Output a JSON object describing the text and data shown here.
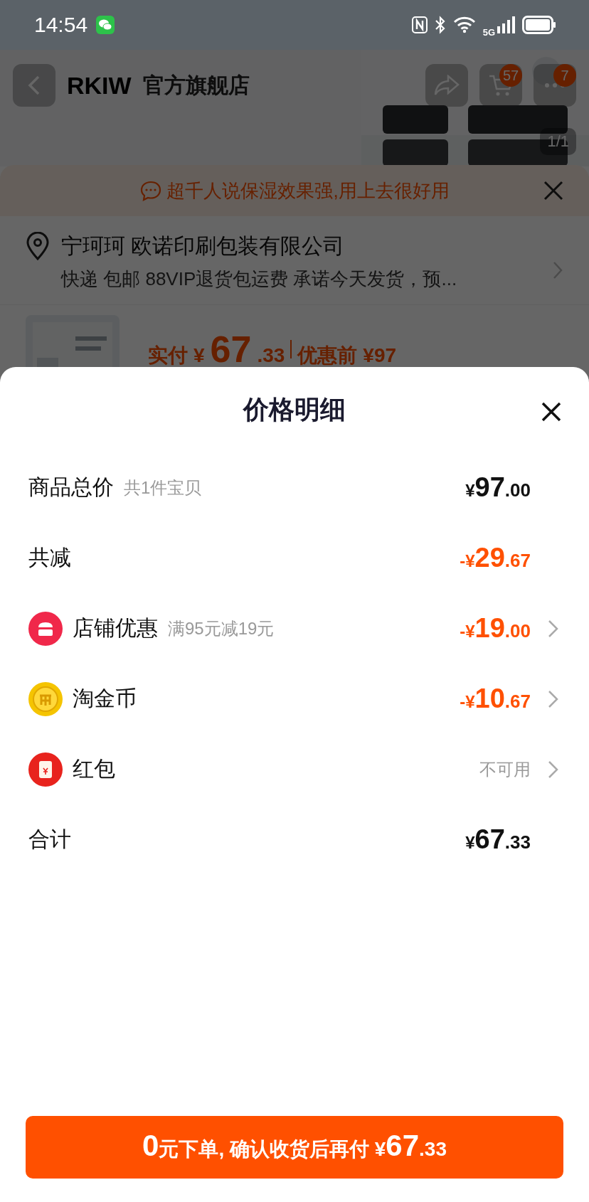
{
  "status_bar": {
    "time": "14:54",
    "network": "5G"
  },
  "header": {
    "brand": "RKIW",
    "store_name": "官方旗舰店",
    "cart_badge": "57",
    "more_badge": "7",
    "image_counter": "1/1"
  },
  "order_sheet": {
    "banner": "超千人说保湿效果强,用上去很好用",
    "address": {
      "name": "宁珂珂 欧诺印刷包装有限公司",
      "delivery": "快递 包邮 88VIP退货包运费 承诺今天发货，预..."
    },
    "product": {
      "paid_label": "实付",
      "currency": "¥",
      "paid_main": "67",
      "paid_decimal": ".33",
      "before_label": "优惠前",
      "before_price": "¥97"
    }
  },
  "price_detail": {
    "title": "价格明细",
    "rows": [
      {
        "kind": "plain",
        "label": "商品总价",
        "note": "共1件宝贝",
        "value": {
          "kind": "amount",
          "discount": false,
          "prefix": "¥",
          "main": "97",
          "decimal": ".00"
        },
        "chevron": false
      },
      {
        "kind": "plain",
        "label": "共减",
        "value": {
          "kind": "amount",
          "discount": true,
          "prefix": "-¥",
          "main": "29",
          "decimal": ".67"
        },
        "chevron": false
      },
      {
        "kind": "store",
        "label": "店铺优惠",
        "note": "满95元减19元",
        "value": {
          "kind": "amount",
          "discount": true,
          "prefix": "-¥",
          "main": "19",
          "decimal": ".00"
        },
        "chevron": true
      },
      {
        "kind": "coin",
        "label": "淘金币",
        "value": {
          "kind": "amount",
          "discount": true,
          "prefix": "-¥",
          "main": "10",
          "decimal": ".67"
        },
        "chevron": true
      },
      {
        "kind": "envelope",
        "label": "红包",
        "value": {
          "kind": "status",
          "text": "不可用"
        },
        "chevron": true
      },
      {
        "kind": "plain",
        "label": "合计",
        "value": {
          "kind": "amount",
          "discount": false,
          "prefix": "¥",
          "main": "67",
          "decimal": ".33"
        },
        "chevron": false
      }
    ],
    "button": {
      "lead_number": "0",
      "text": "元下单, 确认收货后再付 ¥",
      "amount_main": "67",
      "amount_decimal": ".33"
    }
  }
}
